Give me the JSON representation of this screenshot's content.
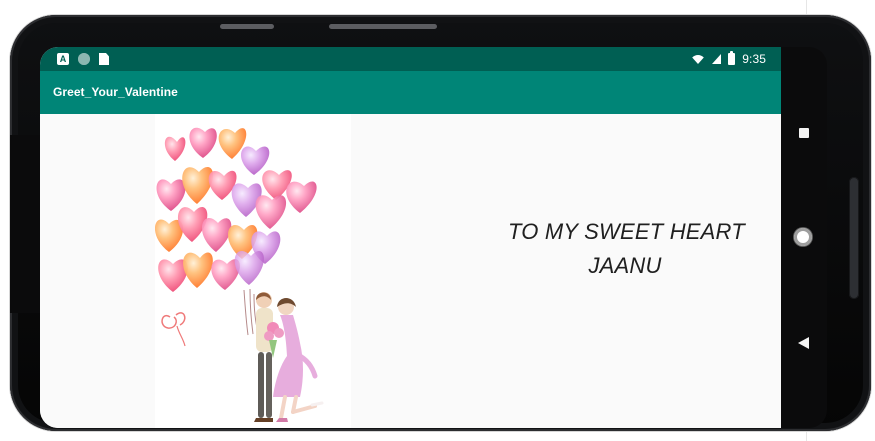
{
  "device": {
    "theme_colors": {
      "status_bar": "#005f53",
      "app_bar": "#008577",
      "screen_background": "#fafafa",
      "text_primary": "#202020"
    }
  },
  "status_bar": {
    "time": "9:35",
    "left_icons": [
      {
        "name": "a-icon",
        "label": "A"
      },
      {
        "name": "circle-icon"
      },
      {
        "name": "sd-card-icon"
      }
    ],
    "right_icons": [
      {
        "name": "wifi-icon"
      },
      {
        "name": "signal-icon"
      },
      {
        "name": "battery-icon"
      }
    ]
  },
  "app_bar": {
    "title": "Greet_Your_Valentine"
  },
  "content": {
    "message_lines": [
      "TO MY SWEET HEART",
      "JAANU"
    ]
  },
  "navigation": {
    "buttons": [
      {
        "name": "recent-apps-icon"
      },
      {
        "name": "home-icon"
      },
      {
        "name": "back-icon"
      }
    ]
  }
}
